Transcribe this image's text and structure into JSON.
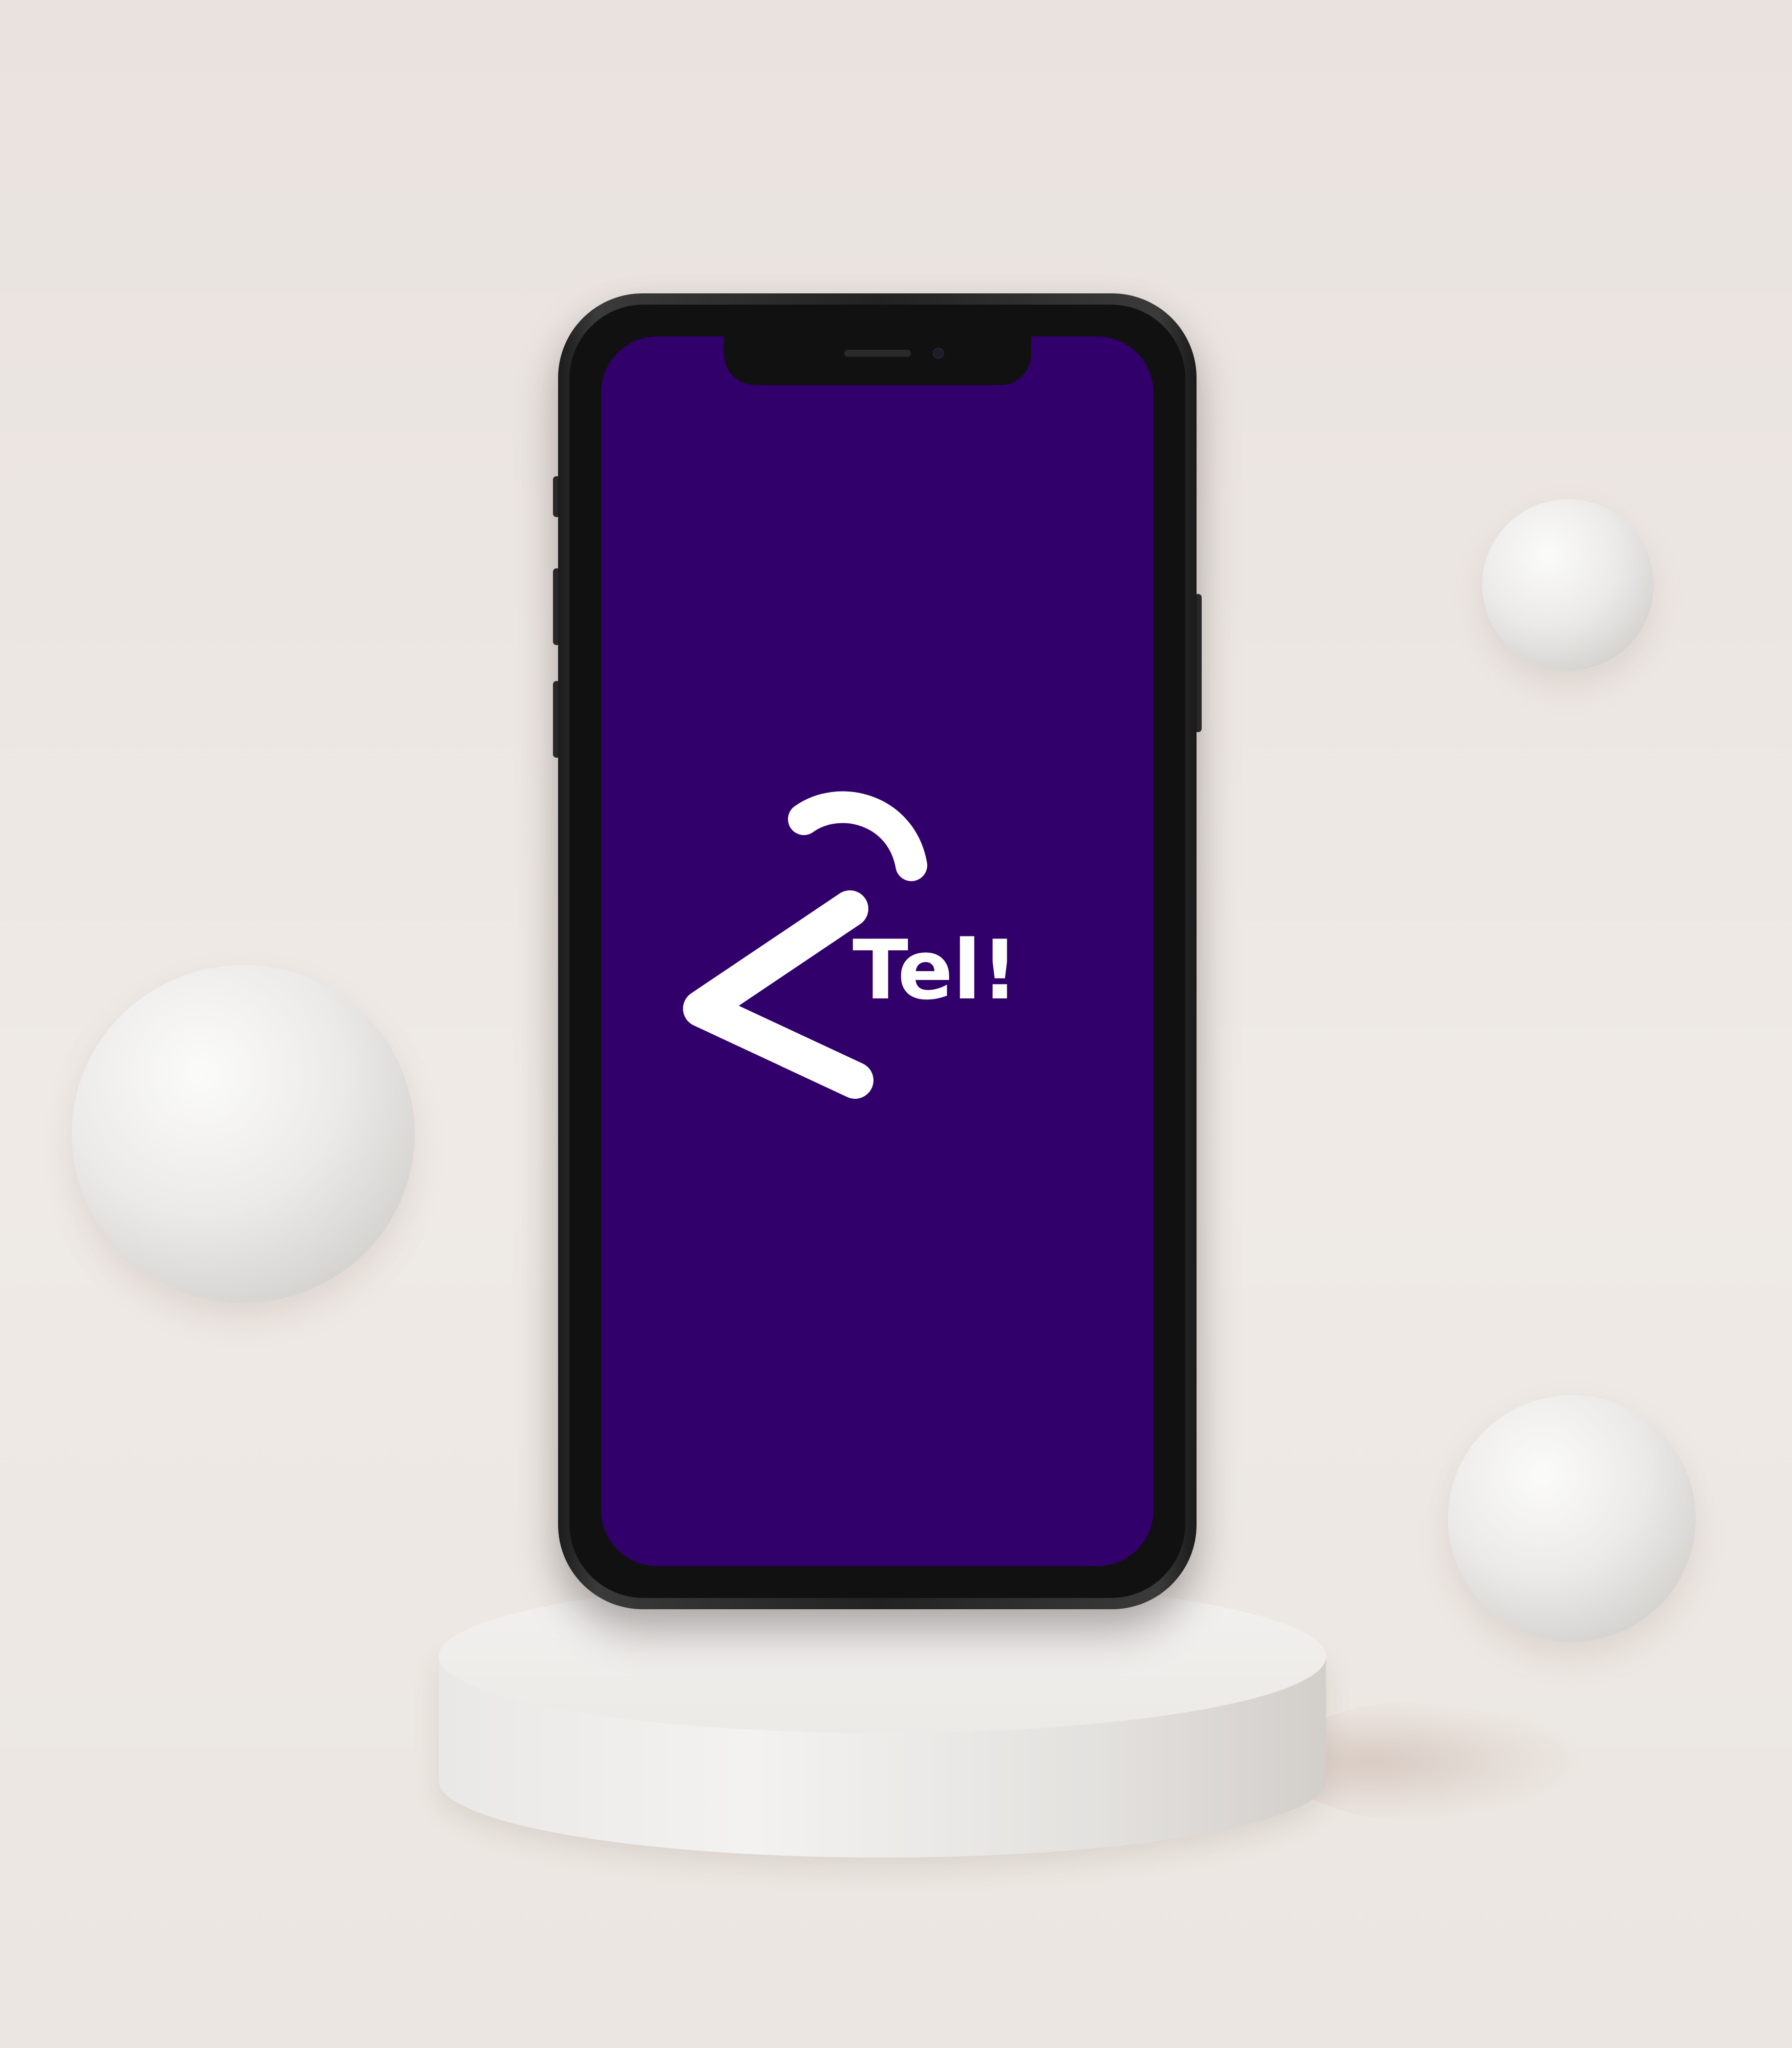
{
  "app": {
    "logo_text": "Tel!",
    "screen_color": "#31006b",
    "logo_color": "#ffffff"
  },
  "scene": {
    "background_color": "#ece6e2",
    "phone_frame_color": "#2a2a2a",
    "sphere_color": "#ebeae8"
  }
}
